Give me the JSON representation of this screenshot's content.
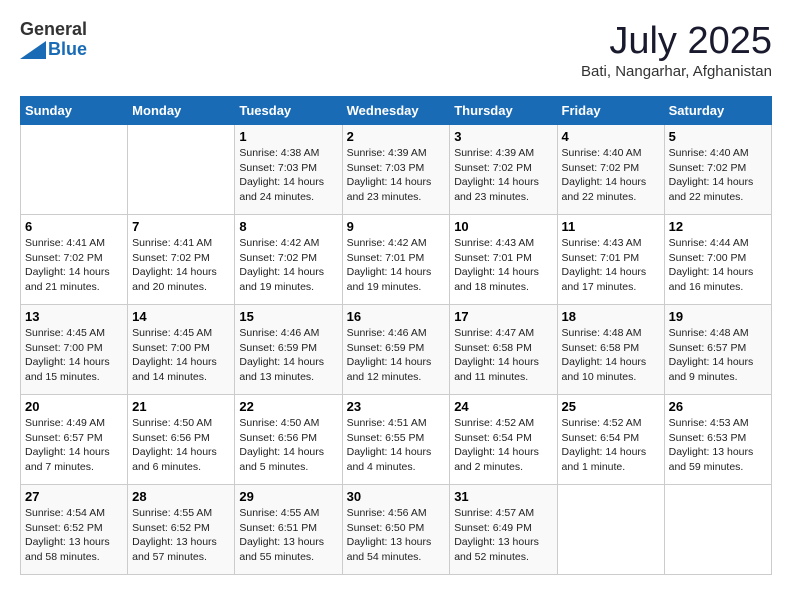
{
  "logo": {
    "general": "General",
    "blue": "Blue"
  },
  "title": "July 2025",
  "location": "Bati, Nangarhar, Afghanistan",
  "days_of_week": [
    "Sunday",
    "Monday",
    "Tuesday",
    "Wednesday",
    "Thursday",
    "Friday",
    "Saturday"
  ],
  "weeks": [
    [
      {
        "day": "",
        "content": ""
      },
      {
        "day": "",
        "content": ""
      },
      {
        "day": "1",
        "content": "Sunrise: 4:38 AM\nSunset: 7:03 PM\nDaylight: 14 hours and 24 minutes."
      },
      {
        "day": "2",
        "content": "Sunrise: 4:39 AM\nSunset: 7:03 PM\nDaylight: 14 hours and 23 minutes."
      },
      {
        "day": "3",
        "content": "Sunrise: 4:39 AM\nSunset: 7:02 PM\nDaylight: 14 hours and 23 minutes."
      },
      {
        "day": "4",
        "content": "Sunrise: 4:40 AM\nSunset: 7:02 PM\nDaylight: 14 hours and 22 minutes."
      },
      {
        "day": "5",
        "content": "Sunrise: 4:40 AM\nSunset: 7:02 PM\nDaylight: 14 hours and 22 minutes."
      }
    ],
    [
      {
        "day": "6",
        "content": "Sunrise: 4:41 AM\nSunset: 7:02 PM\nDaylight: 14 hours and 21 minutes."
      },
      {
        "day": "7",
        "content": "Sunrise: 4:41 AM\nSunset: 7:02 PM\nDaylight: 14 hours and 20 minutes."
      },
      {
        "day": "8",
        "content": "Sunrise: 4:42 AM\nSunset: 7:02 PM\nDaylight: 14 hours and 19 minutes."
      },
      {
        "day": "9",
        "content": "Sunrise: 4:42 AM\nSunset: 7:01 PM\nDaylight: 14 hours and 19 minutes."
      },
      {
        "day": "10",
        "content": "Sunrise: 4:43 AM\nSunset: 7:01 PM\nDaylight: 14 hours and 18 minutes."
      },
      {
        "day": "11",
        "content": "Sunrise: 4:43 AM\nSunset: 7:01 PM\nDaylight: 14 hours and 17 minutes."
      },
      {
        "day": "12",
        "content": "Sunrise: 4:44 AM\nSunset: 7:00 PM\nDaylight: 14 hours and 16 minutes."
      }
    ],
    [
      {
        "day": "13",
        "content": "Sunrise: 4:45 AM\nSunset: 7:00 PM\nDaylight: 14 hours and 15 minutes."
      },
      {
        "day": "14",
        "content": "Sunrise: 4:45 AM\nSunset: 7:00 PM\nDaylight: 14 hours and 14 minutes."
      },
      {
        "day": "15",
        "content": "Sunrise: 4:46 AM\nSunset: 6:59 PM\nDaylight: 14 hours and 13 minutes."
      },
      {
        "day": "16",
        "content": "Sunrise: 4:46 AM\nSunset: 6:59 PM\nDaylight: 14 hours and 12 minutes."
      },
      {
        "day": "17",
        "content": "Sunrise: 4:47 AM\nSunset: 6:58 PM\nDaylight: 14 hours and 11 minutes."
      },
      {
        "day": "18",
        "content": "Sunrise: 4:48 AM\nSunset: 6:58 PM\nDaylight: 14 hours and 10 minutes."
      },
      {
        "day": "19",
        "content": "Sunrise: 4:48 AM\nSunset: 6:57 PM\nDaylight: 14 hours and 9 minutes."
      }
    ],
    [
      {
        "day": "20",
        "content": "Sunrise: 4:49 AM\nSunset: 6:57 PM\nDaylight: 14 hours and 7 minutes."
      },
      {
        "day": "21",
        "content": "Sunrise: 4:50 AM\nSunset: 6:56 PM\nDaylight: 14 hours and 6 minutes."
      },
      {
        "day": "22",
        "content": "Sunrise: 4:50 AM\nSunset: 6:56 PM\nDaylight: 14 hours and 5 minutes."
      },
      {
        "day": "23",
        "content": "Sunrise: 4:51 AM\nSunset: 6:55 PM\nDaylight: 14 hours and 4 minutes."
      },
      {
        "day": "24",
        "content": "Sunrise: 4:52 AM\nSunset: 6:54 PM\nDaylight: 14 hours and 2 minutes."
      },
      {
        "day": "25",
        "content": "Sunrise: 4:52 AM\nSunset: 6:54 PM\nDaylight: 14 hours and 1 minute."
      },
      {
        "day": "26",
        "content": "Sunrise: 4:53 AM\nSunset: 6:53 PM\nDaylight: 13 hours and 59 minutes."
      }
    ],
    [
      {
        "day": "27",
        "content": "Sunrise: 4:54 AM\nSunset: 6:52 PM\nDaylight: 13 hours and 58 minutes."
      },
      {
        "day": "28",
        "content": "Sunrise: 4:55 AM\nSunset: 6:52 PM\nDaylight: 13 hours and 57 minutes."
      },
      {
        "day": "29",
        "content": "Sunrise: 4:55 AM\nSunset: 6:51 PM\nDaylight: 13 hours and 55 minutes."
      },
      {
        "day": "30",
        "content": "Sunrise: 4:56 AM\nSunset: 6:50 PM\nDaylight: 13 hours and 54 minutes."
      },
      {
        "day": "31",
        "content": "Sunrise: 4:57 AM\nSunset: 6:49 PM\nDaylight: 13 hours and 52 minutes."
      },
      {
        "day": "",
        "content": ""
      },
      {
        "day": "",
        "content": ""
      }
    ]
  ]
}
